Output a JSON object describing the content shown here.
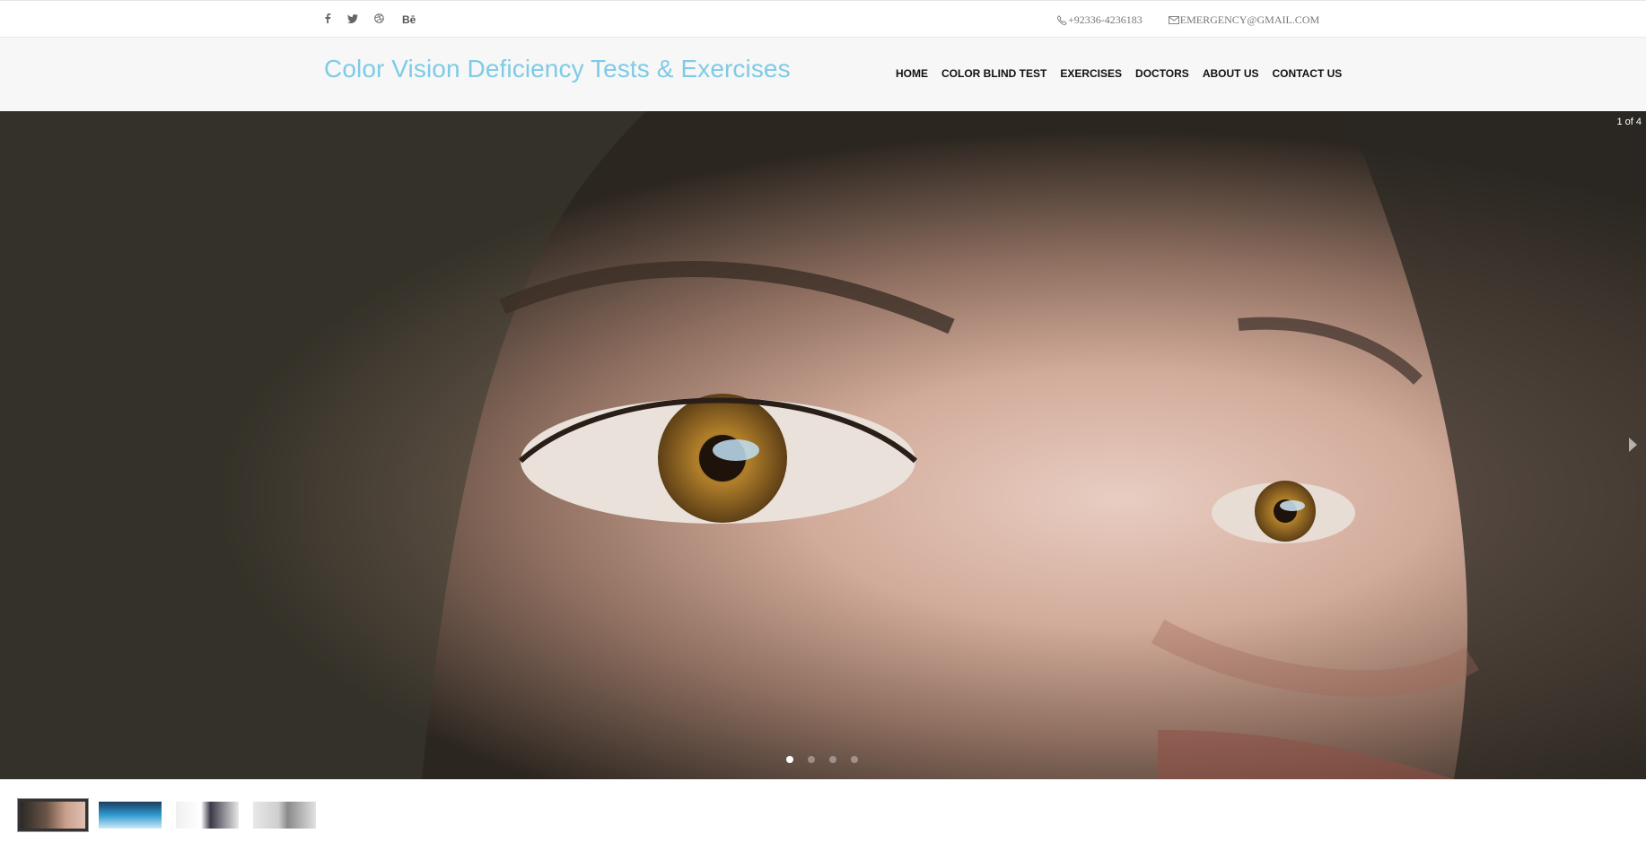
{
  "topbar": {
    "social_icons": [
      "facebook-icon",
      "twitter-icon",
      "dribbble-icon",
      "behance-icon"
    ],
    "behance_text": "Bē",
    "phone": "+92336-4236183",
    "email": "EMERGENCY@GMAIL.COM"
  },
  "header": {
    "logo": "Color Vision Deficiency Tests & Exercises",
    "logo_color": "#7ecbe6",
    "nav": [
      "HOME",
      "COLOR BLIND TEST",
      "EXERCISES",
      "DOCTORS",
      "ABOUT US",
      "CONTACT US"
    ]
  },
  "slider": {
    "counter": "1 of 4",
    "active_slide": 1,
    "total_slides": 4
  }
}
